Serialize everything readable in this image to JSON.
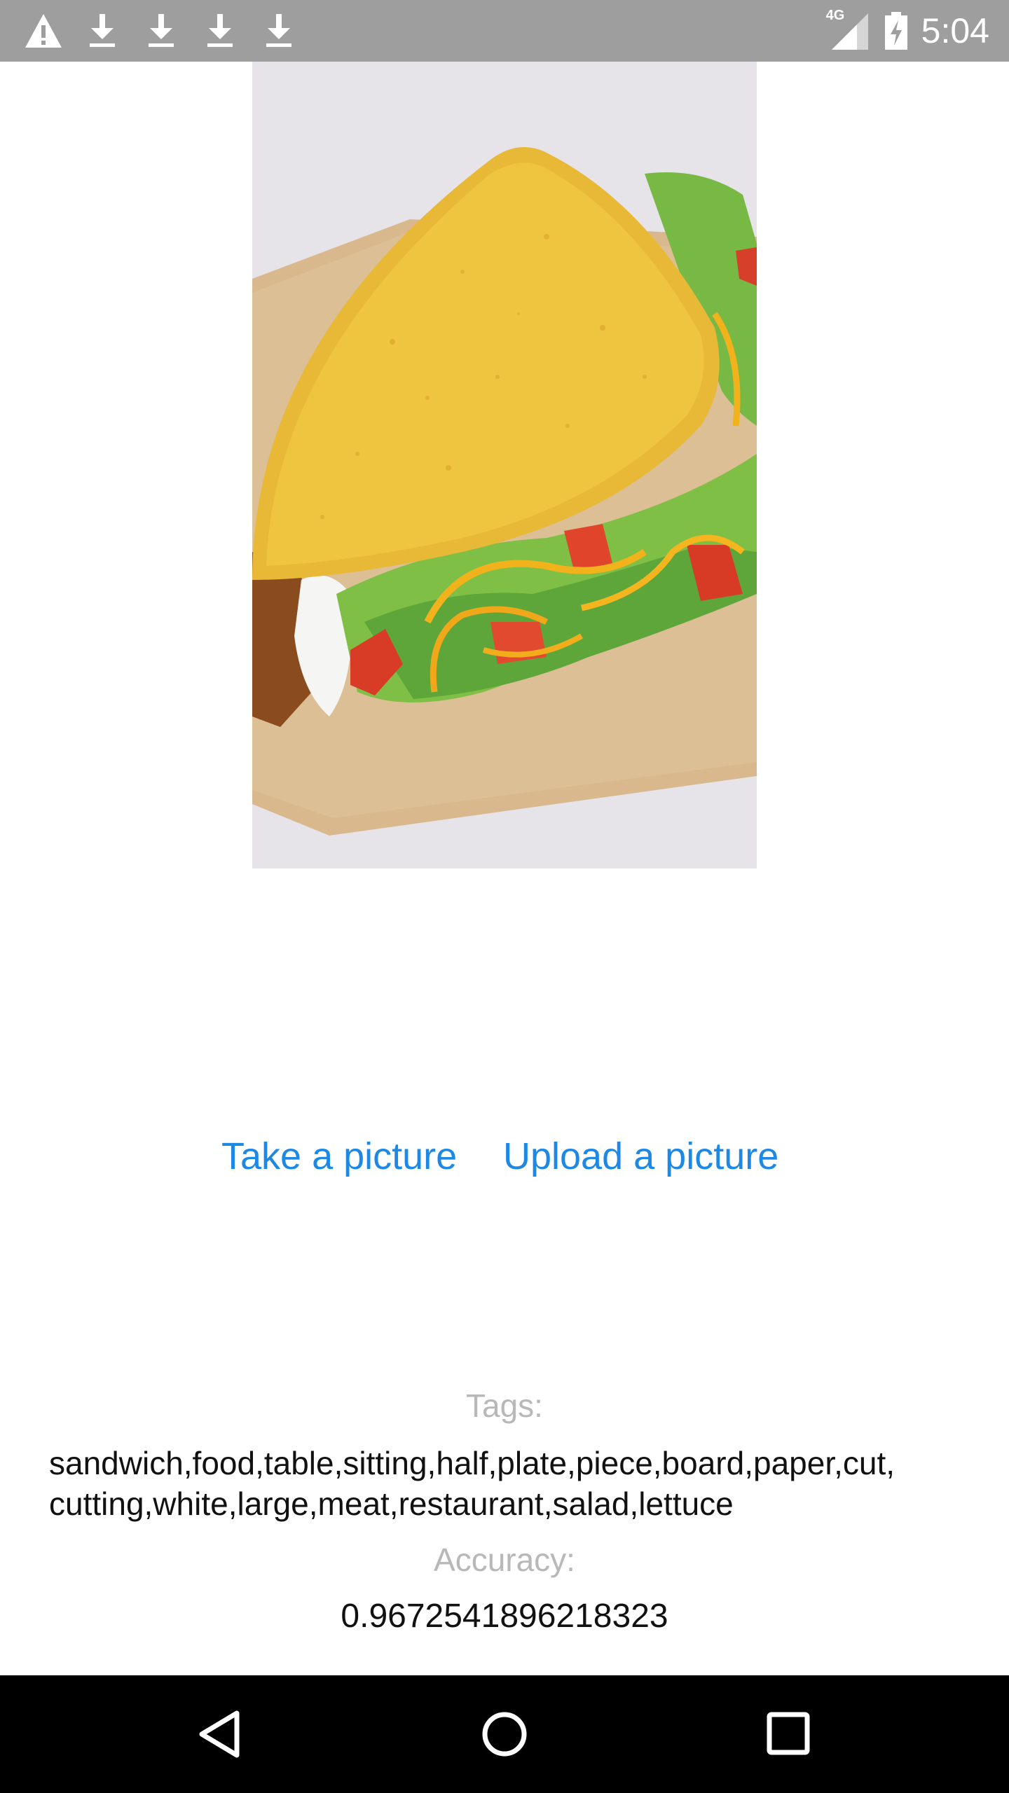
{
  "status_bar": {
    "time": "5:04",
    "network": "4G",
    "icons": [
      "warning-icon",
      "download-icon",
      "download-icon",
      "download-icon",
      "download-icon"
    ]
  },
  "actions": {
    "take_label": "Take a picture",
    "upload_label": "Upload a picture"
  },
  "results": {
    "tags_label": "Tags:",
    "tags_value": "sandwich,food,table,sitting,half,plate,piece,board,paper,cut,\ncutting,white,large,meat,restaurant,salad,lettuce",
    "accuracy_label": "Accuracy:",
    "accuracy_value": "0.9672541896218323"
  },
  "colors": {
    "accent": "#1e88e5",
    "status_bar": "#9e9e9e",
    "nav_bar": "#000000"
  }
}
